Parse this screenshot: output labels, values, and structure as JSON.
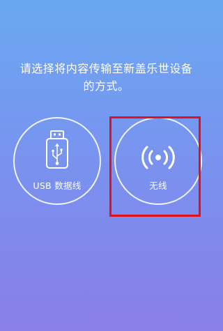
{
  "instruction": {
    "line1": "请选择将内容传输至新盖乐世设备",
    "line2": "的方式。"
  },
  "options": [
    {
      "label": "USB 数据线",
      "icon": "usb-drive-icon"
    },
    {
      "label": "无线",
      "icon": "wireless-broadcast-icon"
    }
  ],
  "colors": {
    "background_top": "#6aa8f2",
    "background_bottom": "#8a7ee8",
    "foreground": "#ffffff",
    "highlight": "#e0121d"
  }
}
